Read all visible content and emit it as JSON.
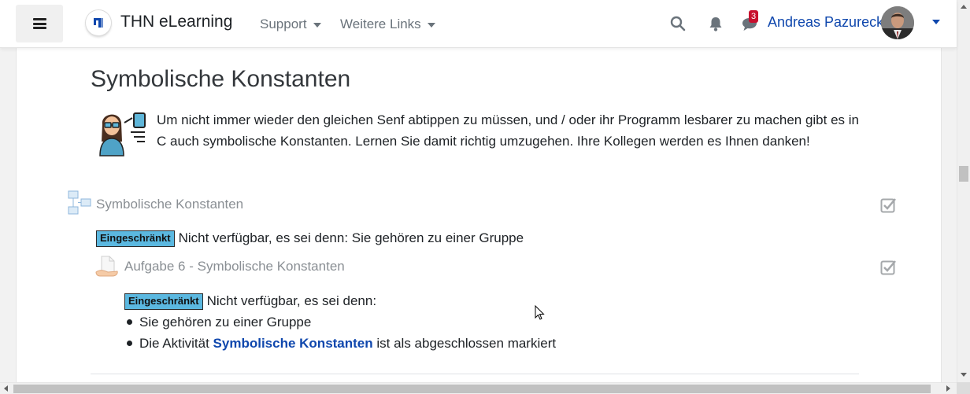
{
  "navbar": {
    "site_name": "THN eLearning",
    "menu": [
      {
        "label": "Support"
      },
      {
        "label": "Weitere Links"
      }
    ],
    "message_count": "3",
    "user_name": "Andreas Pazureck",
    "accent_color": "#0f47ad"
  },
  "main": {
    "title": "Symbolische Konstanten",
    "summary": "Um nicht immer wieder den gleichen Senf abtippen zu müssen, und / oder ihr Programm lesbarer zu machen gibt es in C auch symbolische Konstanten. Lernen Sie damit richtig umzugehen. Ihre Kollegen werden es Ihnen danken!",
    "activities": [
      {
        "name": "Symbolische Konstanten",
        "icon": "lesson-icon",
        "restriction_label": "Eingeschränkt",
        "restriction_text": "Nicht verfügbar, es sei denn: Sie gehören zu einer Gruppe"
      },
      {
        "name": "Aufgabe 6 - Symbolische Konstanten",
        "icon": "assignment-icon",
        "restriction_label": "Eingeschränkt",
        "restriction_intro": "Nicht verfügbar, es sei denn:",
        "conditions": [
          {
            "text": "Sie gehören zu einer Gruppe"
          },
          {
            "prefix": "Die Aktivität ",
            "link": "Symbolische Konstanten",
            "suffix": " ist als abgeschlossen markiert"
          }
        ]
      }
    ]
  },
  "colors": {
    "restricted_badge": "#5bb8e0",
    "notification_badge": "#c8102e"
  }
}
